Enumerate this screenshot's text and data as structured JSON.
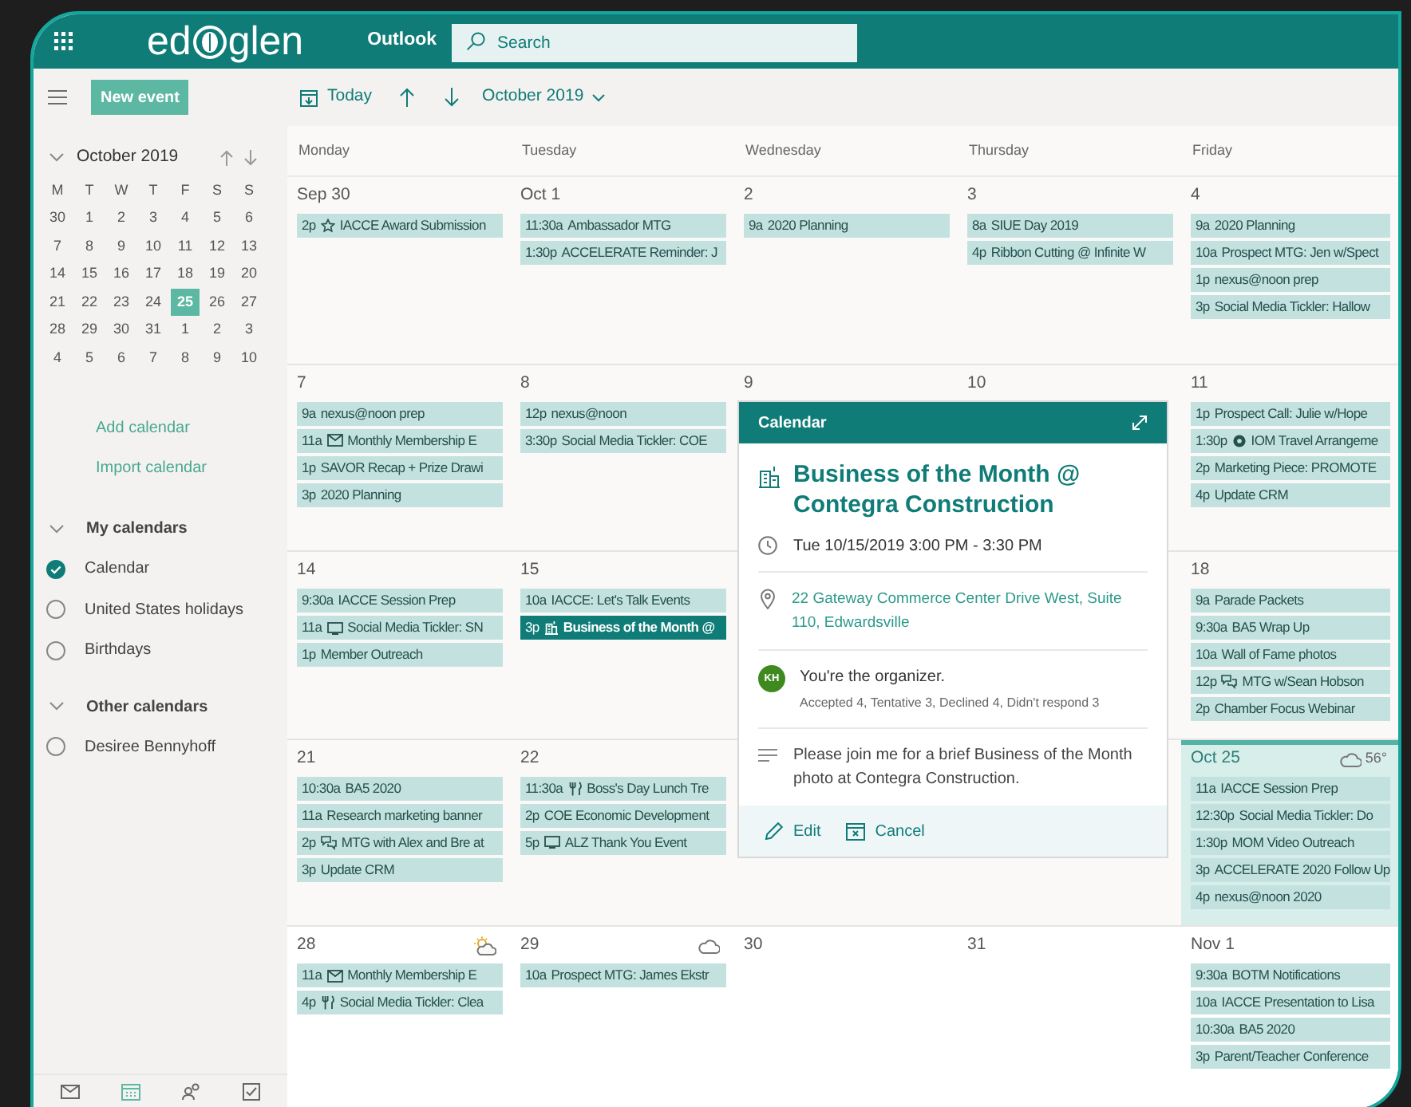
{
  "top_bar": {
    "brand_left": "ed",
    "brand_right": "glen",
    "app_name": "Outlook",
    "search": {
      "placeholder": "Search"
    }
  },
  "toolbar": {
    "new_event": "New event",
    "today": "Today",
    "month": "October 2019"
  },
  "mini_calendar": {
    "title": "October 2019",
    "weekdays": [
      "M",
      "T",
      "W",
      "T",
      "F",
      "S",
      "S"
    ],
    "weeks": [
      [
        {
          "day": "30",
          "selected": false
        },
        {
          "day": "1",
          "selected": false
        },
        {
          "day": "2",
          "selected": false
        },
        {
          "day": "3",
          "selected": false
        },
        {
          "day": "4",
          "selected": false
        },
        {
          "day": "5",
          "selected": false
        },
        {
          "day": "6",
          "selected": false
        }
      ],
      [
        {
          "day": "7",
          "selected": false
        },
        {
          "day": "8",
          "selected": false
        },
        {
          "day": "9",
          "selected": false
        },
        {
          "day": "10",
          "selected": false
        },
        {
          "day": "11",
          "selected": false
        },
        {
          "day": "12",
          "selected": false
        },
        {
          "day": "13",
          "selected": false
        }
      ],
      [
        {
          "day": "14",
          "selected": false
        },
        {
          "day": "15",
          "selected": false
        },
        {
          "day": "16",
          "selected": false
        },
        {
          "day": "17",
          "selected": false
        },
        {
          "day": "18",
          "selected": false
        },
        {
          "day": "19",
          "selected": false
        },
        {
          "day": "20",
          "selected": false
        }
      ],
      [
        {
          "day": "21",
          "selected": false
        },
        {
          "day": "22",
          "selected": false
        },
        {
          "day": "23",
          "selected": false
        },
        {
          "day": "24",
          "selected": false
        },
        {
          "day": "25",
          "selected": true
        },
        {
          "day": "26",
          "selected": false
        },
        {
          "day": "27",
          "selected": false
        }
      ],
      [
        {
          "day": "28",
          "selected": false
        },
        {
          "day": "29",
          "selected": false
        },
        {
          "day": "30",
          "selected": false
        },
        {
          "day": "31",
          "selected": false
        },
        {
          "day": "1",
          "selected": false
        },
        {
          "day": "2",
          "selected": false
        },
        {
          "day": "3",
          "selected": false
        }
      ],
      [
        {
          "day": "4",
          "selected": false
        },
        {
          "day": "5",
          "selected": false
        },
        {
          "day": "6",
          "selected": false
        },
        {
          "day": "7",
          "selected": false
        },
        {
          "day": "8",
          "selected": false
        },
        {
          "day": "9",
          "selected": false
        },
        {
          "day": "10",
          "selected": false
        }
      ]
    ]
  },
  "sidebar_links": [
    "Add calendar",
    "Import calendar"
  ],
  "calendar_groups": [
    {
      "name": "My calendars",
      "expanded": true,
      "items": [
        {
          "label": "Calendar",
          "checked": true
        },
        {
          "label": "United States holidays",
          "checked": false
        },
        {
          "label": "Birthdays",
          "checked": false
        }
      ]
    },
    {
      "name": "Other calendars",
      "expanded": true,
      "items": [
        {
          "label": "Desiree Bennyhoff",
          "checked": false
        }
      ]
    }
  ],
  "bottom_nav": [
    {
      "kind": "mail",
      "selected": false
    },
    {
      "kind": "calendar",
      "selected": true
    },
    {
      "kind": "people",
      "selected": false
    },
    {
      "kind": "tasks",
      "selected": false
    }
  ],
  "weekday_headers": [
    "Monday",
    "Tuesday",
    "Wednesday",
    "Thursday",
    "Friday"
  ],
  "weeks": [
    {
      "days": [
        {
          "date": "Sep 30",
          "today": false,
          "events": [
            {
              "time": "2p",
              "kind": "star",
              "title": "IACCE Award Submission",
              "selected": false
            }
          ]
        },
        {
          "date": "Oct 1",
          "today": false,
          "events": [
            {
              "time": "11:30a",
              "kind": "plain",
              "title": "Ambassador MTG",
              "selected": false
            },
            {
              "time": "1:30p",
              "kind": "plain",
              "title": "ACCELERATE Reminder: J",
              "selected": false
            }
          ]
        },
        {
          "date": "2",
          "today": false,
          "events": [
            {
              "time": "9a",
              "kind": "plain",
              "title": "2020 Planning",
              "selected": false
            }
          ]
        },
        {
          "date": "3",
          "today": false,
          "events": [
            {
              "time": "8a",
              "kind": "plain",
              "title": "SIUE Day 2019",
              "selected": false
            },
            {
              "time": "4p",
              "kind": "plain",
              "title": "Ribbon Cutting @ Infinite W",
              "selected": false
            }
          ]
        },
        {
          "date": "4",
          "today": false,
          "events": [
            {
              "time": "9a",
              "kind": "plain",
              "title": "2020 Planning",
              "selected": false
            },
            {
              "time": "10a",
              "kind": "plain",
              "title": "Prospect MTG: Jen w/Spect",
              "selected": false
            },
            {
              "time": "1p",
              "kind": "plain",
              "title": "nexus@noon prep",
              "selected": false
            },
            {
              "time": "3p",
              "kind": "plain",
              "title": "Social Media Tickler: Hallow",
              "selected": false
            }
          ]
        }
      ]
    },
    {
      "days": [
        {
          "date": "7",
          "today": false,
          "events": [
            {
              "time": "9a",
              "kind": "plain",
              "title": "nexus@noon prep",
              "selected": false
            },
            {
              "time": "11a",
              "kind": "mail",
              "title": "Monthly Membership E",
              "selected": false
            },
            {
              "time": "1p",
              "kind": "plain",
              "title": "SAVOR Recap + Prize Drawi",
              "selected": false
            },
            {
              "time": "3p",
              "kind": "plain",
              "title": "2020 Planning",
              "selected": false
            }
          ]
        },
        {
          "date": "8",
          "today": false,
          "events": [
            {
              "time": "12p",
              "kind": "plain",
              "title": "nexus@noon",
              "selected": false
            },
            {
              "time": "3:30p",
              "kind": "plain",
              "title": "Social Media Tickler: COE",
              "selected": false
            }
          ]
        },
        {
          "date": "9",
          "today": false
        },
        {
          "date": "10",
          "today": false
        },
        {
          "date": "11",
          "today": false,
          "events": [
            {
              "time": "1p",
              "kind": "plain",
              "title": "Prospect Call: Julie w/Hope",
              "selected": false
            },
            {
              "time": "1:30p",
              "kind": "badge",
              "title": "IOM Travel Arrangeme",
              "selected": false
            },
            {
              "time": "2p",
              "kind": "plain",
              "title": "Marketing Piece: PROMOTE",
              "selected": false
            },
            {
              "time": "4p",
              "kind": "plain",
              "title": "Update CRM",
              "selected": false
            }
          ]
        }
      ]
    },
    {
      "days": [
        {
          "date": "14",
          "today": false,
          "events": [
            {
              "time": "9:30a",
              "kind": "plain",
              "title": "IACCE Session Prep",
              "selected": false
            },
            {
              "time": "11a",
              "kind": "screen",
              "title": "Social Media Tickler: SN",
              "selected": false
            },
            {
              "time": "1p",
              "kind": "plain",
              "title": "Member Outreach",
              "selected": false
            }
          ]
        },
        {
          "date": "15",
          "today": false,
          "events": [
            {
              "time": "10a",
              "kind": "plain",
              "title": "IACCE: Let's Talk Events",
              "selected": false
            },
            {
              "time": "3p",
              "kind": "building",
              "title": "Business of the Month @",
              "selected": true
            }
          ]
        },
        {
          "date": "18",
          "today": false,
          "events": [
            {
              "time": "9a",
              "kind": "plain",
              "title": "Parade Packets",
              "selected": false
            },
            {
              "time": "9:30a",
              "kind": "plain",
              "title": "BA5 Wrap Up",
              "selected": false
            },
            {
              "time": "10a",
              "kind": "plain",
              "title": "Wall of Fame photos",
              "selected": false
            },
            {
              "time": "12p",
              "kind": "chat",
              "title": "MTG w/Sean Hobson",
              "selected": false
            },
            {
              "time": "2p",
              "kind": "plain",
              "title": "Chamber Focus Webinar",
              "selected": false
            }
          ]
        }
      ]
    },
    {
      "days": [
        {
          "date": "21",
          "today": false,
          "events": [
            {
              "time": "10:30a",
              "kind": "plain",
              "title": "BA5 2020",
              "selected": false
            },
            {
              "time": "11a",
              "kind": "plain",
              "title": "Research marketing banner",
              "selected": false
            },
            {
              "time": "2p",
              "kind": "chat",
              "title": "MTG with Alex and Bre at",
              "selected": false
            },
            {
              "time": "3p",
              "kind": "plain",
              "title": "Update CRM",
              "selected": false
            }
          ]
        },
        {
          "date": "22",
          "today": false,
          "events": [
            {
              "time": "11:30a",
              "kind": "utensils",
              "title": "Boss's Day Lunch Tre",
              "selected": false
            },
            {
              "time": "2p",
              "kind": "plain",
              "title": "COE Economic Development",
              "selected": false
            },
            {
              "time": "5p",
              "kind": "screen",
              "title": "ALZ Thank You Event",
              "selected": false
            }
          ]
        },
        {
          "date": "Oct 25",
          "today": true,
          "weather": {
            "kind": "cloudy",
            "temperature": "56°"
          },
          "events": [
            {
              "time": "11a",
              "kind": "plain",
              "title": "IACCE Session Prep",
              "selected": false
            },
            {
              "time": "12:30p",
              "kind": "plain",
              "title": "Social Media Tickler: Do",
              "selected": false
            },
            {
              "time": "1:30p",
              "kind": "plain",
              "title": "MOM Video Outreach",
              "selected": false
            },
            {
              "time": "3p",
              "kind": "plain",
              "title": "ACCELERATE 2020 Follow Up",
              "selected": false
            },
            {
              "time": "4p",
              "kind": "plain",
              "title": "nexus@noon 2020",
              "selected": false
            }
          ]
        }
      ]
    },
    {
      "days": [
        {
          "date": "28",
          "today": false,
          "weather": {
            "kind": "partly-sunny"
          },
          "events": [
            {
              "time": "11a",
              "kind": "mail",
              "title": "Monthly Membership E",
              "selected": false
            },
            {
              "time": "4p",
              "kind": "utensils",
              "title": "Social Media Tickler: Clea",
              "selected": false
            }
          ]
        },
        {
          "date": "29",
          "today": false,
          "weather": {
            "kind": "cloudy"
          },
          "events": [
            {
              "time": "10a",
              "kind": "plain",
              "title": "Prospect MTG: James Ekstr",
              "selected": false
            }
          ]
        },
        {
          "date": "30",
          "today": false
        },
        {
          "date": "31",
          "today": false
        },
        {
          "date": "Nov 1",
          "today": false,
          "events": [
            {
              "time": "9:30a",
              "kind": "plain",
              "title": "BOTM Notifications",
              "selected": false
            },
            {
              "time": "10a",
              "kind": "plain",
              "title": "IACCE Presentation to Lisa",
              "selected": false
            },
            {
              "time": "10:30a",
              "kind": "plain",
              "title": "BA5 2020",
              "selected": false
            },
            {
              "time": "3p",
              "kind": "plain",
              "title": "Parent/Teacher Conference",
              "selected": false
            }
          ]
        }
      ]
    }
  ],
  "popup": {
    "header": "Calendar",
    "title": "Business of the Month @ Contegra Construction",
    "time": "Tue 10/15/2019 3:00 PM - 3:30 PM",
    "location": "22 Gateway Commerce Center Drive West, Suite 110, Edwardsville",
    "organizer_initials": "KH",
    "organizer_note": "You're the organizer.",
    "responses": "Accepted 4, Tentative 3, Declined 4, Didn't respond 3",
    "description": "Please join me for a brief Business of the Month photo at Contegra Construction.",
    "actions": [
      {
        "kind": "edit",
        "label": "Edit"
      },
      {
        "kind": "cancel",
        "label": "Cancel"
      }
    ]
  }
}
